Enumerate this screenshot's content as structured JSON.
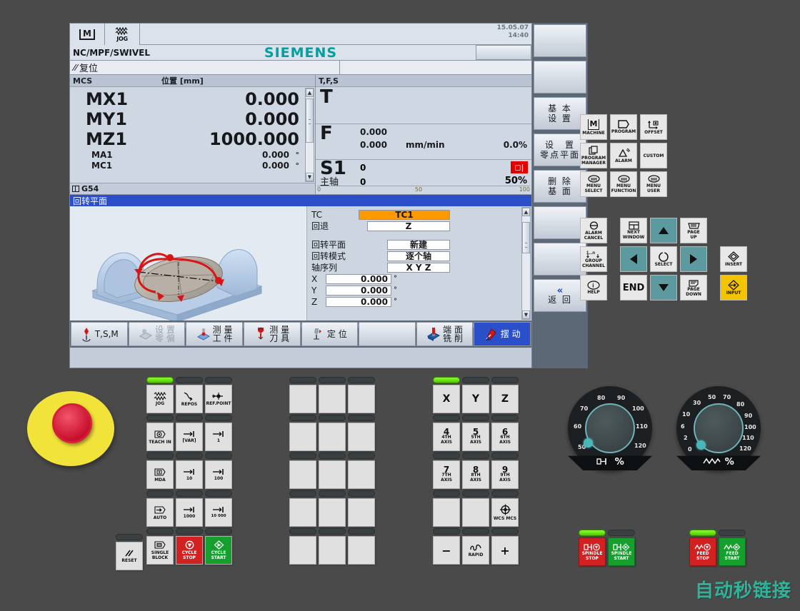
{
  "hmi": {
    "toolbar": {
      "machine_icon": "machine-M-icon",
      "mode_icon": "jog-wave-icon",
      "mode_label": "JOG"
    },
    "datetime": {
      "date": "15.05.07",
      "time": "14:40"
    },
    "program_path": "NC/MPF/SWIVEL",
    "brand": "SIEMENS",
    "status": {
      "icon": "reset-slash-icon",
      "text": "复位"
    },
    "position": {
      "header_left": "MCS",
      "header_right": "位置 [mm]",
      "axes": [
        {
          "name": "MX1",
          "value": "0.000",
          "unit": ""
        },
        {
          "name": "MY1",
          "value": "0.000",
          "unit": ""
        },
        {
          "name": "MZ1",
          "value": "1000.000",
          "unit": ""
        }
      ],
      "rot_axes": [
        {
          "name": "MA1",
          "value": "0.000",
          "unit": "°"
        },
        {
          "name": "MC1",
          "value": "0.000",
          "unit": "°"
        }
      ],
      "work_offset": "G54"
    },
    "tfs": {
      "header": "T,F,S",
      "tool_label": "T",
      "tool_value": "",
      "feed_label": "F",
      "feed_actual": "0.000",
      "feed_set": "0.000",
      "feed_unit": "mm/min",
      "feed_percent": "0.0%",
      "spindle_label": "S1",
      "spindle_sub": "主轴",
      "spindle_actual": "0",
      "spindle_set": "0",
      "spindle_percent": "50%",
      "spindle_state_icon": "spindle-stop-icon",
      "scale_ticks": [
        "0",
        "50",
        "100"
      ]
    },
    "dialog": {
      "title": "回转平面",
      "graphic": "swivel-table-3d-illustration",
      "fields": [
        {
          "label": "TC",
          "value": "TC1",
          "highlight": true
        },
        {
          "label": "回退",
          "value": "Z",
          "highlight": false
        },
        {
          "label": "回转平面",
          "value": "新建",
          "highlight": false
        },
        {
          "label": "回转模式",
          "value": "逐个轴",
          "highlight": false
        },
        {
          "label": "轴序列",
          "value": "X Y Z",
          "highlight": false
        }
      ],
      "angles": [
        {
          "label": "X",
          "value": "0.000",
          "unit": "°"
        },
        {
          "label": "Y",
          "value": "0.000",
          "unit": "°"
        },
        {
          "label": "Z",
          "value": "0.000",
          "unit": "°"
        }
      ],
      "next_arrow": "▶"
    },
    "vertical_softkeys": [
      {
        "label": "",
        "icon": ""
      },
      {
        "label": "",
        "icon": ""
      },
      {
        "line1": "基 本",
        "line2": "设 置"
      },
      {
        "line1": "设　置",
        "line2": "零点平面"
      },
      {
        "line1": "删 除",
        "line2": "基 面"
      },
      {
        "label": "",
        "icon": ""
      },
      {
        "label": "",
        "icon": ""
      },
      {
        "chev": "«",
        "line2": "返 回"
      }
    ],
    "horizontal_softkeys": [
      {
        "label": "T,S,M",
        "icon": "tool-tsm-icon",
        "state": "normal"
      },
      {
        "line1": "设 置",
        "line2": "零 偏",
        "icon": "workoffset-icon",
        "state": "disabled"
      },
      {
        "line1": "测 量",
        "line2": "工 件",
        "icon": "measure-workpiece-icon",
        "state": "normal"
      },
      {
        "line1": "测 量",
        "line2": "刀 具",
        "icon": "measure-tool-icon",
        "state": "normal"
      },
      {
        "label": "定 位",
        "icon": "position-icon",
        "state": "normal"
      },
      {
        "label": "",
        "icon": "",
        "state": "normal"
      },
      {
        "line1": "端 面",
        "line2": "铣 削",
        "icon": "face-milling-icon",
        "state": "normal"
      },
      {
        "label": "摆 动",
        "icon": "swivel-icon",
        "state": "selected"
      }
    ]
  },
  "keypad": {
    "function_keys": [
      {
        "label": "MACHINE",
        "icon": "machine-M-icon"
      },
      {
        "label": "PROGRAM",
        "icon": "program-icon"
      },
      {
        "label": "OFFSET",
        "icon": "offset-axes-icon"
      },
      {
        "line1": "PROGRAM",
        "line2": "MANAGER",
        "icon": "program-manager-icon"
      },
      {
        "label": "ALARM",
        "icon": "alarm-triangle-icon"
      },
      {
        "label": "CUSTOM",
        "icon": ""
      },
      {
        "line1": "MENU",
        "line2": "SELECT",
        "icon": "menu-key-icon"
      },
      {
        "line1": "MENU",
        "line2": "FUNCTION",
        "icon": "menu-key-icon"
      },
      {
        "line1": "MENU",
        "line2": "USER",
        "icon": "menu-key-icon"
      }
    ],
    "nav_keys": [
      {
        "line1": "ALARM",
        "line2": "CANCEL",
        "icon": "alarm-cancel-icon",
        "style": "light"
      },
      {
        "line1": "NEXT",
        "line2": "WINDOW",
        "icon": "next-window-icon",
        "style": "light"
      },
      {
        "label": "",
        "icon": "arrow-up-icon",
        "style": "teal"
      },
      {
        "line1": "PAGE",
        "line2": "UP",
        "icon": "page-up-icon",
        "style": "light"
      },
      {
        "line1": "GROUP",
        "line2": "CHANNEL",
        "icon": "group-channel-icon",
        "style": "light"
      },
      {
        "label": "",
        "icon": "arrow-left-icon",
        "style": "teal"
      },
      {
        "label": "SELECT",
        "icon": "select-circle-icon",
        "style": "light"
      },
      {
        "label": "",
        "icon": "arrow-right-icon",
        "style": "teal"
      },
      {
        "label": "INSERT",
        "icon": "insert-icon",
        "style": "light"
      },
      {
        "label": "HELP",
        "icon": "help-info-icon",
        "style": "light"
      },
      {
        "label": "END",
        "icon": "",
        "style": "light"
      },
      {
        "label": "",
        "icon": "arrow-down-icon",
        "style": "teal"
      },
      {
        "line1": "PAGE",
        "line2": "DOWN",
        "icon": "page-down-icon",
        "style": "light"
      },
      {
        "label": "INPUT",
        "icon": "input-icon",
        "style": "yellow"
      }
    ]
  },
  "mcp": {
    "emergency_stop": "emergency-stop-button",
    "reset_key": {
      "label": "RESET",
      "icon": "reset-slash-icon"
    },
    "mode_keys": [
      {
        "label": "JOG",
        "icon": "jog-wave-icon"
      },
      {
        "label": "REPOS",
        "icon": "repos-icon"
      },
      {
        "label": "REF.POINT",
        "icon": "ref-point-icon"
      },
      {
        "line1": "TEACH IN",
        "icon": "teach-in-icon"
      },
      {
        "label": "[VAR]",
        "icon": "step-arrow-icon"
      },
      {
        "label": "1",
        "icon": "step-arrow-icon"
      },
      {
        "label": "MDA",
        "icon": "mda-icon"
      },
      {
        "label": "10",
        "icon": "step-arrow-icon"
      },
      {
        "label": "100",
        "icon": "step-arrow-icon"
      },
      {
        "label": "AUTO",
        "icon": "auto-icon"
      },
      {
        "label": "1000",
        "icon": "step-arrow-icon"
      },
      {
        "label": "10 000",
        "icon": "step-arrow-icon"
      }
    ],
    "control_keys": [
      {
        "line1": "SINGLE",
        "line2": "BLOCK",
        "icon": "single-block-icon",
        "color": "light"
      },
      {
        "line1": "CYCLE",
        "line2": "STOP",
        "icon": "cycle-stop-icon",
        "color": "red"
      },
      {
        "line1": "CYCLE",
        "line2": "START",
        "icon": "cycle-start-icon",
        "color": "green"
      }
    ],
    "axis_keys": [
      {
        "label": "X",
        "sub": ""
      },
      {
        "label": "Y",
        "sub": ""
      },
      {
        "label": "Z",
        "sub": ""
      },
      {
        "label": "4",
        "sub1": "4TH",
        "sub2": "AXIS"
      },
      {
        "label": "5",
        "sub1": "5TH",
        "sub2": "AXIS"
      },
      {
        "label": "6",
        "sub1": "6TH",
        "sub2": "AXIS"
      },
      {
        "label": "7",
        "sub1": "7TH",
        "sub2": "AXIS"
      },
      {
        "label": "8",
        "sub1": "8TH",
        "sub2": "AXIS"
      },
      {
        "label": "9",
        "sub1": "9TH",
        "sub2": "AXIS"
      },
      {
        "label": "",
        "sub": ""
      },
      {
        "label": "",
        "sub": ""
      },
      {
        "label": "",
        "sub": "WCS MCS",
        "icon": "wcs-mcs-icon"
      },
      {
        "label": "−",
        "sub": ""
      },
      {
        "label": "",
        "sub": "RAPID",
        "icon": "rapid-icon"
      },
      {
        "label": "+",
        "sub": ""
      }
    ],
    "spindle_dial": {
      "unit_label": "%",
      "icon": "spindle-icon",
      "ticks": [
        "50",
        "60",
        "70",
        "80",
        "90",
        "100",
        "110",
        "120"
      ],
      "value": 50
    },
    "feed_dial": {
      "unit_label": "%",
      "icon": "feed-wave-icon",
      "ticks": [
        "0",
        "2",
        "6",
        "10",
        "30",
        "50",
        "70",
        "80",
        "90",
        "100",
        "110",
        "120"
      ],
      "value": 0
    },
    "spindle_buttons": [
      {
        "line1": "SPINDLE",
        "line2": "STOP",
        "color": "red",
        "icon": "spindle-stop-icon"
      },
      {
        "line1": "SPINDLE",
        "line2": "START",
        "color": "green",
        "icon": "spindle-start-icon"
      }
    ],
    "feed_buttons": [
      {
        "line1": "FEED",
        "line2": "STOP",
        "color": "red",
        "icon": "feed-stop-icon"
      },
      {
        "line1": "FEED",
        "line2": "START",
        "color": "green",
        "icon": "feed-start-icon"
      }
    ]
  },
  "watermark": "自动秒链接"
}
